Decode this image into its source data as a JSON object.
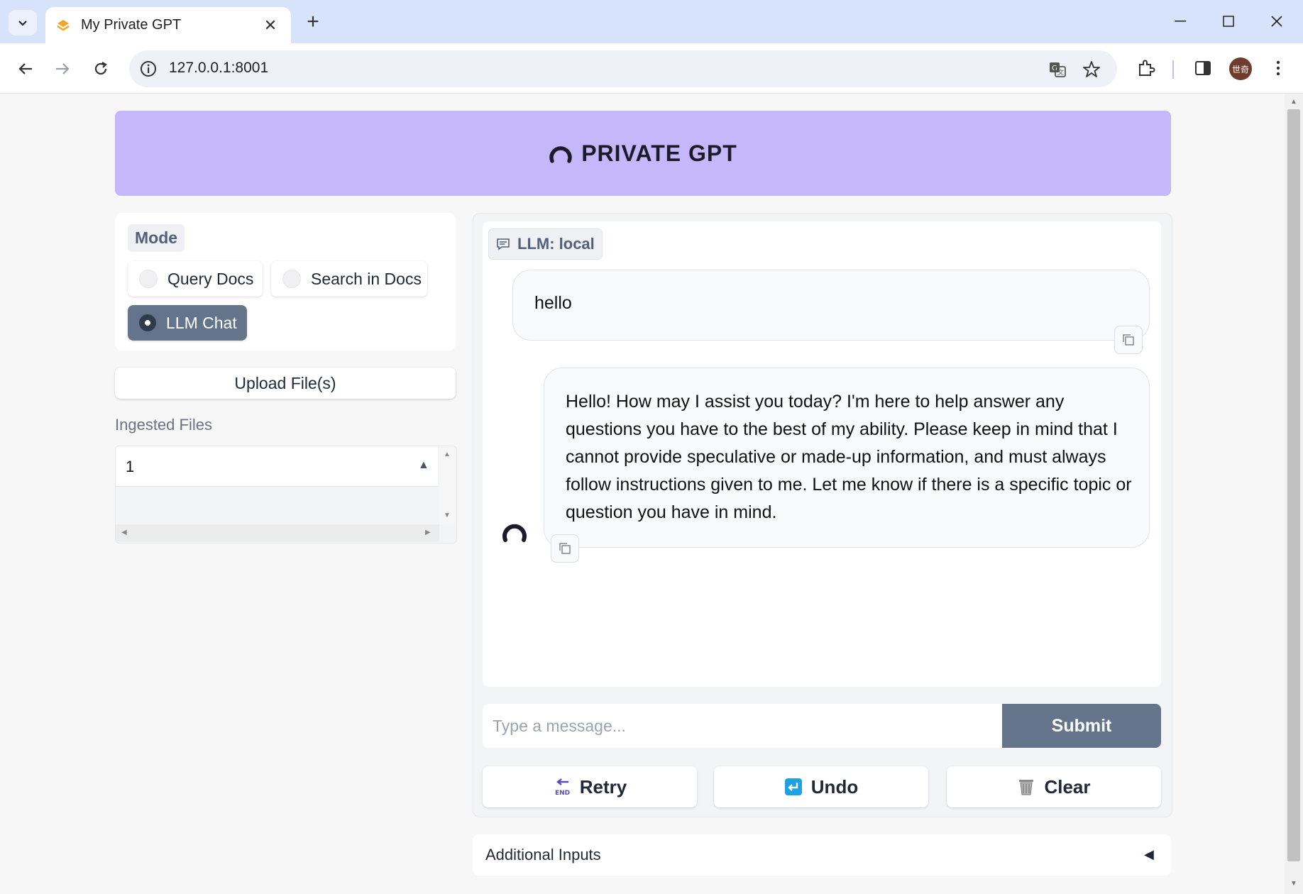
{
  "browser": {
    "tab_title": "My Private GPT",
    "url": "127.0.0.1:8001",
    "avatar_text": "世奇"
  },
  "header": {
    "brand": "PRIVATE GPT",
    "color": "#c4b8fb"
  },
  "mode": {
    "label": "Mode",
    "options": [
      {
        "label": "Query Docs",
        "selected": false
      },
      {
        "label": "Search in Docs",
        "selected": false
      },
      {
        "label": "LLM Chat",
        "selected": true
      }
    ]
  },
  "upload": {
    "label": "Upload File(s)"
  },
  "ingested": {
    "label": "Ingested Files",
    "header": "1"
  },
  "chat": {
    "badge": "LLM: local",
    "messages": [
      {
        "role": "user",
        "text": "hello"
      },
      {
        "role": "assistant",
        "text": "Hello! How may I assist you today? I'm here to help answer any questions you have to the best of my ability. Please keep in mind that I cannot provide speculative or made-up information, and must always follow instructions given to me. Let me know if there is a specific topic or question you have in mind."
      }
    ],
    "input_placeholder": "Type a message...",
    "submit_label": "Submit",
    "retry_label": "Retry",
    "undo_label": "Undo",
    "clear_label": "Clear"
  },
  "additional_inputs": {
    "label": "Additional Inputs"
  },
  "icons": {
    "tab_favicon": "privategpt-favicon",
    "bot": "privategpt-logo-icon",
    "retry": "end-arrow-icon",
    "undo": "return-arrow-icon",
    "clear": "wastebasket-icon"
  }
}
